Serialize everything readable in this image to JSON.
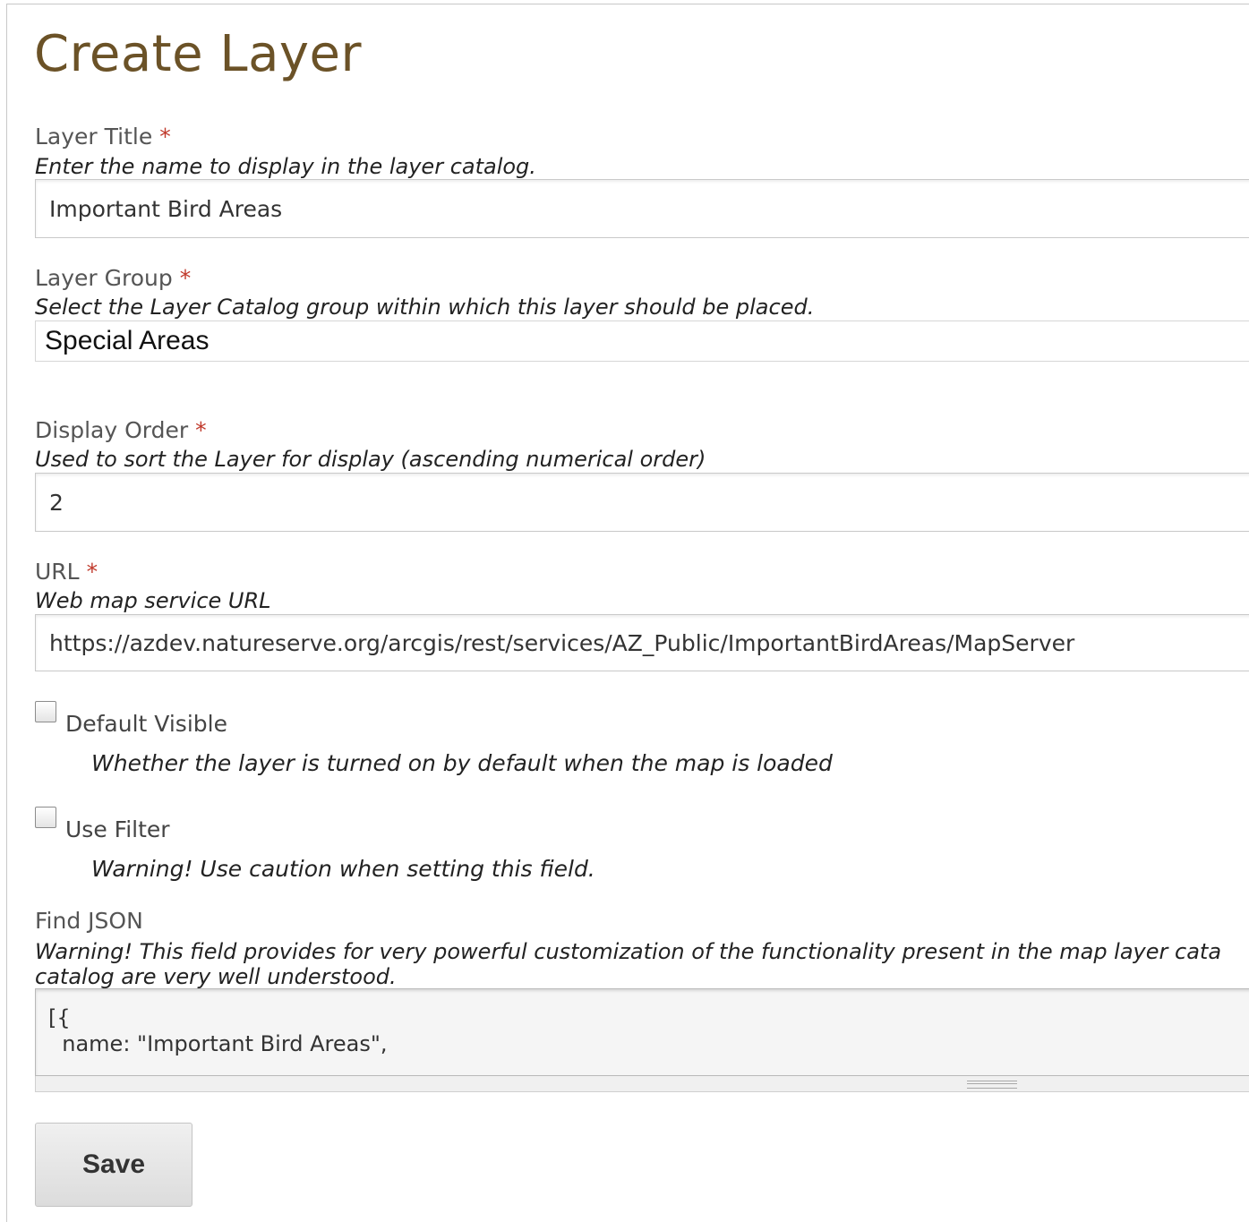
{
  "page": {
    "title": "Create Layer"
  },
  "form": {
    "required_marker": "*",
    "layer_title": {
      "label": "Layer Title",
      "hint": "Enter the name to display in the layer catalog.",
      "value": "Important Bird Areas"
    },
    "layer_group": {
      "label": "Layer Group",
      "hint": "Select the Layer Catalog group within which this layer should be placed.",
      "selected": "Special Areas"
    },
    "display_order": {
      "label": "Display Order",
      "hint": "Used to sort the Layer for display (ascending numerical order)",
      "value": "2"
    },
    "url": {
      "label": "URL",
      "hint": "Web map service URL",
      "value": "https://azdev.natureserve.org/arcgis/rest/services/AZ_Public/ImportantBirdAreas/MapServer"
    },
    "default_visible": {
      "label": "Default Visible",
      "hint": "Whether the layer is turned on by default when the map is loaded",
      "checked": false
    },
    "use_filter": {
      "label": "Use Filter",
      "hint": "Warning! Use caution when setting this field.",
      "checked": false
    },
    "find_json": {
      "label": "Find JSON",
      "hint_line1": "Warning! This field provides for very powerful customization of the functionality present in the map layer cata",
      "hint_line2": "catalog are very well understood.",
      "value": "[{\n  name: \"Important Bird Areas\","
    },
    "save_label": "Save"
  }
}
